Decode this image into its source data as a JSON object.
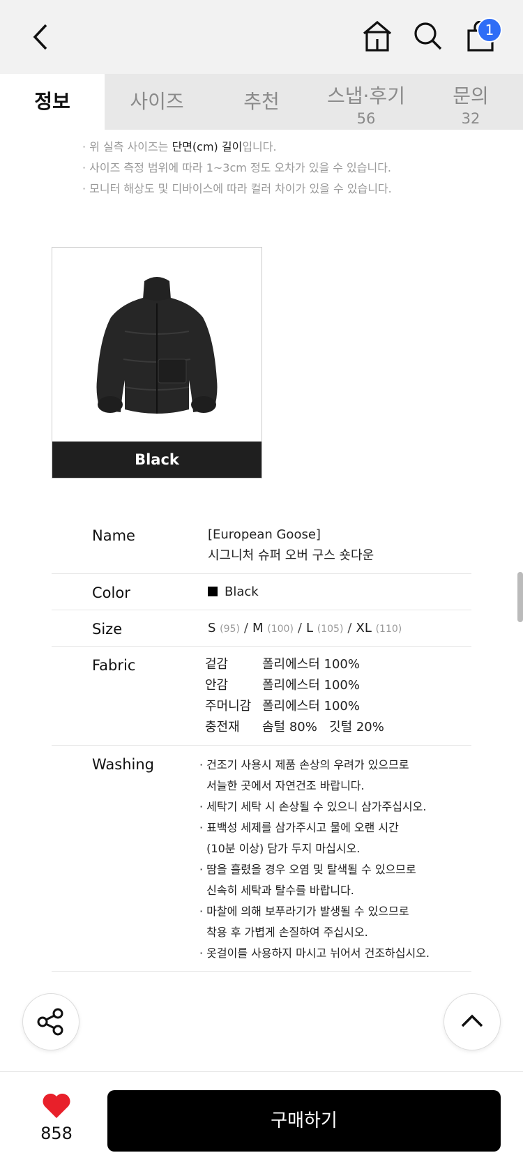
{
  "header": {
    "cart_count": "1"
  },
  "tabs": [
    {
      "label": "정보",
      "count": ""
    },
    {
      "label": "사이즈",
      "count": ""
    },
    {
      "label": "추천",
      "count": ""
    },
    {
      "label": "스냅·후기",
      "count": "56"
    },
    {
      "label": "문의",
      "count": "32"
    }
  ],
  "notes": {
    "line1_prefix": "· 위 실측 사이즈는 ",
    "line1_bold": "단면(cm) 길이",
    "line1_suffix": "입니다.",
    "line2": "· 사이즈 측정 범위에 따라 1~3cm 정도 오차가 있을 수 있습니다.",
    "line3": "· 모니터 해상도 및 디바이스에 따라 컬러 차이가 있을 수 있습니다."
  },
  "product_image": {
    "color_caption": "Black"
  },
  "spec": {
    "name_key": "Name",
    "name_line1": "[European Goose]",
    "name_line2": "시그니처 슈퍼 오버 구스 숏다운",
    "color_key": "Color",
    "color_value": "Black",
    "size_key": "Size",
    "sizes": [
      {
        "size": "S",
        "num": "(95)"
      },
      {
        "size": "M",
        "num": "(100)"
      },
      {
        "size": "L",
        "num": "(105)"
      },
      {
        "size": "XL",
        "num": "(110)"
      }
    ],
    "size_separator": "/",
    "fabric_key": "Fabric",
    "fabric": [
      {
        "part": "겉감",
        "material": "폴리에스터 100%"
      },
      {
        "part": "안감",
        "material": "폴리에스터 100%"
      },
      {
        "part": "주머니감",
        "material": "폴리에스터 100%"
      },
      {
        "part": "충전재",
        "material": "솜털 80%   깃털 20%"
      }
    ],
    "washing_key": "Washing",
    "washing": [
      "· 건조기 사용시 제품 손상의 우려가 있으므로",
      "  서늘한 곳에서 자연건조 바랍니다.",
      "· 세탁기 세탁 시 손상될 수 있으니 삼가주십시오.",
      "· 표백성 세제를 삼가주시고 물에 오랜 시간",
      "  (10분 이상) 담가 두지 마십시오.",
      "· 땀을 흘렸을 경우 오염 및 탈색될 수 있으므로",
      "  신속히 세탁과 탈수를 바랍니다.",
      "· 마찰에 의해 보푸라기가 발생될 수 있으므로",
      "  착용 후 가볍게 손질하여 주십시오.",
      "· 옷걸이를 사용하지 마시고 뉘어서 건조하십시오."
    ]
  },
  "bottom": {
    "like_count": "858",
    "buy_label": "구매하기"
  },
  "colors": {
    "cart_badge": "#2f6df6",
    "heart": "#e8202a",
    "buy_button": "#000000"
  }
}
